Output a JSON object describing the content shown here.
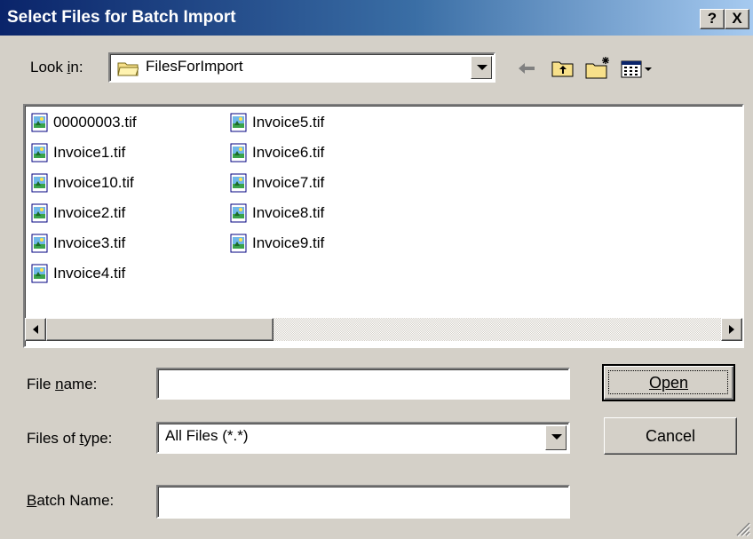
{
  "title": "Select Files for Batch Import",
  "title_buttons": {
    "help": "?",
    "close": "X"
  },
  "look_in": {
    "label": "Look in:",
    "folder": "FilesForImport"
  },
  "toolbar": [
    "back-icon",
    "up-folder-icon",
    "new-folder-icon",
    "view-menu-icon"
  ],
  "files": {
    "column1": [
      "00000003.tif",
      "Invoice1.tif",
      "Invoice10.tif",
      "Invoice2.tif",
      "Invoice3.tif",
      "Invoice4.tif"
    ],
    "column2": [
      "Invoice5.tif",
      "Invoice6.tif",
      "Invoice7.tif",
      "Invoice8.tif",
      "Invoice9.tif"
    ]
  },
  "file_name": {
    "label": "File name:",
    "value": ""
  },
  "files_of_type": {
    "label": "Files of type:",
    "value": "All Files (*.*)"
  },
  "batch_name": {
    "label": "Batch Name:",
    "value": ""
  },
  "buttons": {
    "open": "Open",
    "cancel": "Cancel"
  },
  "colors": {
    "titlebar_start": "#0a246a",
    "titlebar_end": "#a6caf0",
    "face": "#d4d0c8"
  }
}
